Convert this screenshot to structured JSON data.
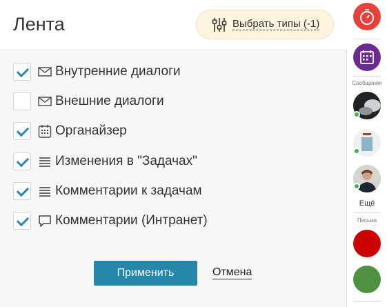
{
  "header": {
    "title": "Лента",
    "types_button_label": "Выбрать типы (-1)"
  },
  "filters": [
    {
      "label": "Внутренние диалоги",
      "checked": true,
      "icon": "envelope-icon"
    },
    {
      "label": "Внешние диалоги",
      "checked": false,
      "icon": "envelope-icon"
    },
    {
      "label": "Органайзер",
      "checked": true,
      "icon": "calendar-icon"
    },
    {
      "label": "Изменения в \"Задачах\"",
      "checked": true,
      "icon": "lines-icon"
    },
    {
      "label": "Комментарии к задачам",
      "checked": true,
      "icon": "lines-icon"
    },
    {
      "label": "Комментарии (Интранет)",
      "checked": true,
      "icon": "speech-bubble-icon"
    }
  ],
  "footer": {
    "apply_label": "Применить",
    "cancel_label": "Отмена"
  },
  "rail": {
    "messages_caption": "Сообщения",
    "more_label": "Ещё",
    "letters_caption": "Письма",
    "colors": {
      "timer": "#e8403a",
      "calendar": "#6a2c91",
      "letter1": "#cc0000",
      "letter2": "#4f9140"
    }
  },
  "colors": {
    "accent": "#2587a9",
    "check": "#2d86b3",
    "online": "#3ab54a"
  }
}
